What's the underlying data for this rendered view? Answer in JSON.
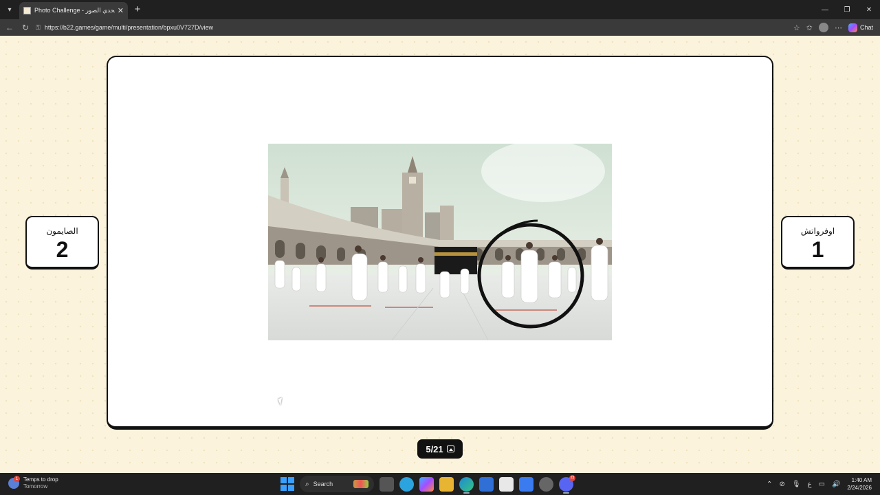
{
  "browser": {
    "tab_title": "Photo Challenge - لعبة تحدي الصور",
    "tab_close": "✕",
    "new_tab": "+",
    "url": "https://b22.games/game/multi/presentation/bpxu0V727D/view",
    "copilot_label": "Chat",
    "window_controls": [
      "—",
      "❐",
      "✕"
    ]
  },
  "game": {
    "image_alt": "Photo of pilgrims in white ihram walking around the Kaaba in Masjid al-Haram",
    "left_team": {
      "name": "الصايمون",
      "score": "2"
    },
    "right_team": {
      "name": "اوفرواتش",
      "score": "1"
    },
    "slide_counter": "5/21"
  },
  "taskbar": {
    "weather_title": "Temps to drop",
    "weather_subtitle": "Tomorrow",
    "weather_badge": "1",
    "search_placeholder": "Search",
    "apps": [
      "task-view",
      "telegram",
      "copilot",
      "file-explorer",
      "edge",
      "mail",
      "store",
      "todo",
      "settings",
      "discord"
    ],
    "discord_badge": "23",
    "lang": "ع",
    "time": "1:40 AM",
    "date": "2/24/2026"
  },
  "colors": {
    "page_bg": "#fbf3dc",
    "card_border": "#111111",
    "counter_bg": "#111111",
    "browser_bg": "#202020"
  }
}
